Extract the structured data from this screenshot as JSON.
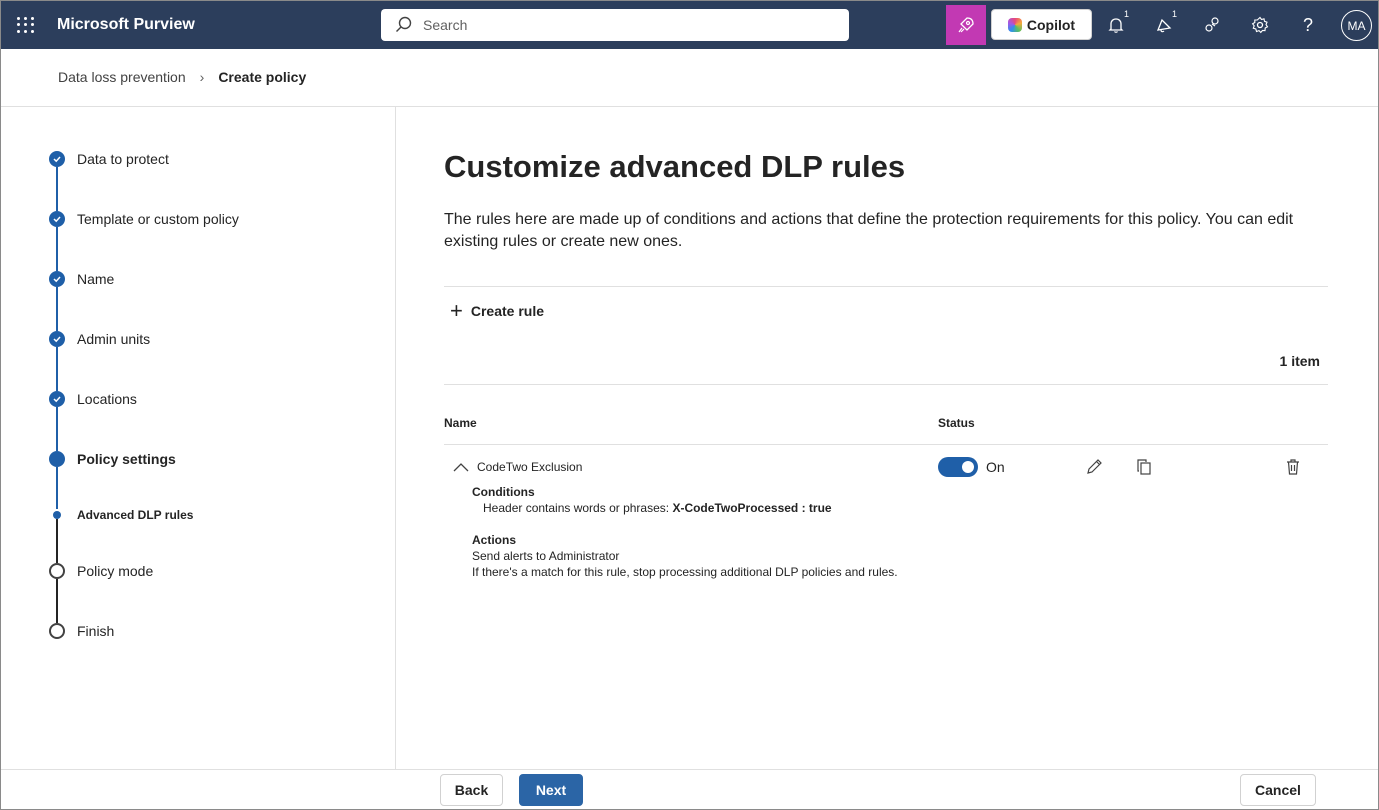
{
  "header": {
    "app_title": "Microsoft Purview",
    "search_placeholder": "Search",
    "copilot_label": "Copilot",
    "notifications_badge": "1",
    "whats_new_badge": "1",
    "avatar_initials": "MA",
    "accent_color": "#c239b3",
    "bar_color": "#2c3e5c"
  },
  "breadcrumb": {
    "parent": "Data loss prevention",
    "current": "Create policy"
  },
  "steps": [
    {
      "label": "Data to protect",
      "state": "done"
    },
    {
      "label": "Template or custom policy",
      "state": "done"
    },
    {
      "label": "Name",
      "state": "done"
    },
    {
      "label": "Admin units",
      "state": "done"
    },
    {
      "label": "Locations",
      "state": "done"
    },
    {
      "label": "Policy settings",
      "state": "current"
    },
    {
      "label": "Advanced DLP rules",
      "state": "current-sub"
    },
    {
      "label": "Policy mode",
      "state": "pending"
    },
    {
      "label": "Finish",
      "state": "pending"
    }
  ],
  "main": {
    "title": "Customize advanced DLP rules",
    "description": "The rules here are made up of conditions and actions that define the protection requirements for this policy. You can edit existing rules or create new ones.",
    "create_rule_label": "Create rule",
    "item_count": "1 item",
    "columns": {
      "name": "Name",
      "status": "Status"
    },
    "rule": {
      "name": "CodeTwo Exclusion",
      "status": "On",
      "conditions_heading": "Conditions",
      "condition_prefix": "Header contains words or phrases:",
      "condition_value": "X-CodeTwoProcessed : true",
      "actions_heading": "Actions",
      "action_1": "Send alerts to Administrator",
      "action_2": "If there's a match for this rule, stop processing additional DLP policies and rules."
    }
  },
  "footer": {
    "back_label": "Back",
    "next_label": "Next",
    "cancel_label": "Cancel"
  }
}
